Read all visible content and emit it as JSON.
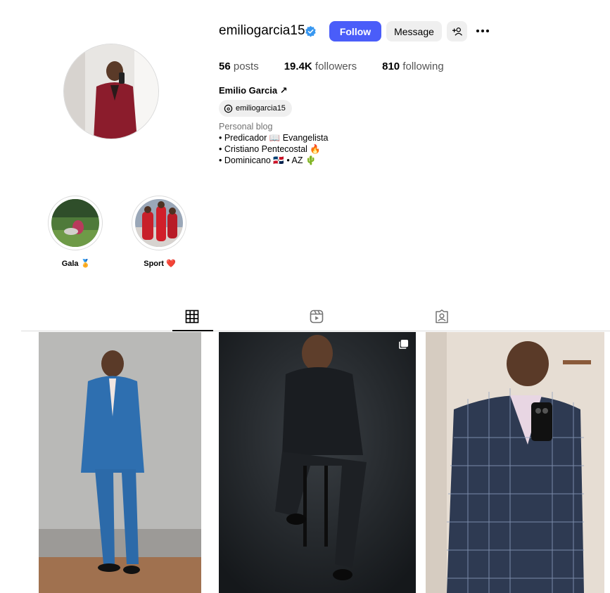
{
  "profile": {
    "username": "emiliogarcia15",
    "verified": true,
    "follow_label": "Follow",
    "message_label": "Message",
    "posts_count": "56",
    "posts_label": "posts",
    "followers_count": "19.4K",
    "followers_label": "followers",
    "following_count": "810",
    "following_label": "following",
    "full_name": "Emilio Garcia ↗",
    "threads_handle": "emiliogarcia15",
    "category": "Personal blog",
    "bio_lines": [
      "• Predicador 📖 Evangelista",
      "• Cristiano Pentecostal 🔥",
      "• Dominicano 🇩🇴 • AZ 🌵"
    ]
  },
  "highlights": [
    {
      "label": "Gala 🏅"
    },
    {
      "label": "Sport ❤️"
    }
  ],
  "tabs": [
    {
      "icon": "grid-icon",
      "active": true
    },
    {
      "icon": "reels-icon",
      "active": false
    },
    {
      "icon": "tagged-icon",
      "active": false
    }
  ],
  "posts": [
    {
      "description": "blue-suit-photo",
      "multi": false
    },
    {
      "description": "black-suit-studio-photo",
      "multi": true
    },
    {
      "description": "plaid-suit-mirror-selfie",
      "multi": false
    }
  ],
  "colors": {
    "accent": "#4a5df9",
    "verified": "#3897f0",
    "button_gray": "#efefef"
  }
}
